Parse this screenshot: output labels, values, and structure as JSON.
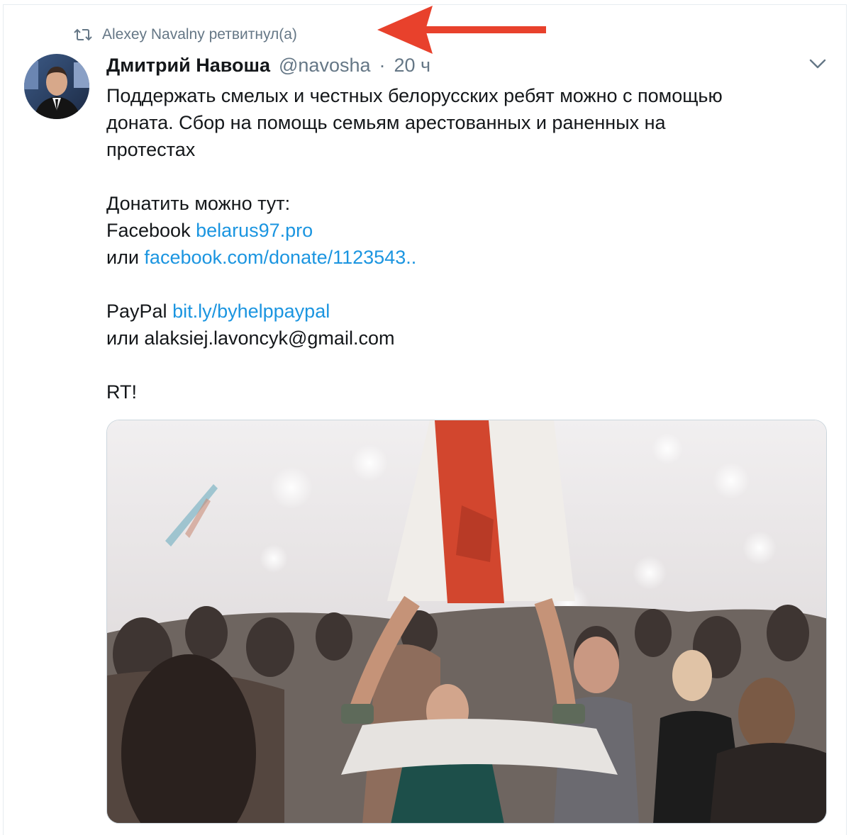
{
  "retweet": {
    "icon": "retweet-icon",
    "text": "Alexey Navalny ретвитнул(а)"
  },
  "annotation": {
    "icon": "red-arrow-icon",
    "color": "#e8412c"
  },
  "tweet": {
    "author_name": "Дмитрий Навоша",
    "author_handle": "@navosha",
    "separator": "·",
    "time": "20 ч",
    "caret_icon": "chevron-down-icon",
    "text_lines": {
      "l1": "Поддержать смелых и честных белорусских ребят можно с помощью",
      "l2": "доната. Сбор на помощь семьям арестованных и раненных на",
      "l3": "протестах",
      "l4": "Донатить можно тут:",
      "l5_prefix": "Facebook ",
      "l5_link": "belarus97.pro",
      "l6_prefix": "или ",
      "l6_link": "facebook.com/donate/1123543..",
      "l7_prefix": "PayPal ",
      "l7_link": "bit.ly/byhelppaypal",
      "l8": "или alaksiej.lavoncyk@gmail.com",
      "l9": "RT!"
    },
    "media_description_icon": "protest-photo-image"
  },
  "colors": {
    "link": "#1b95e0",
    "muted": "#657786",
    "text": "#14171a"
  }
}
